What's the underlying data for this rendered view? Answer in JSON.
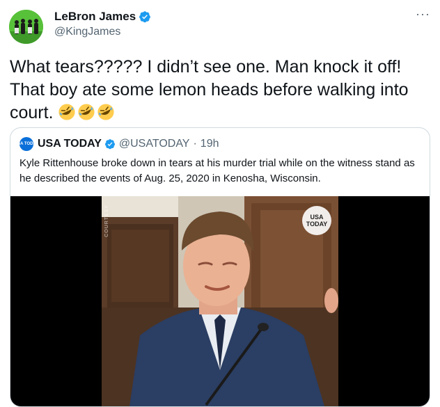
{
  "author": {
    "name": "LeBron James",
    "handle": "@KingJames",
    "avatar_color": "#58c13a"
  },
  "tweet": {
    "text": "What tears????? I didn’t see one. Man knock it off! That boy ate some lemon heads before walking into court.",
    "emojis": [
      "rolling-on-floor-laughing",
      "rolling-on-floor-laughing",
      "rolling-on-floor-laughing"
    ]
  },
  "quote": {
    "avatar_text": "USA TODAY",
    "name": "USA TODAY",
    "handle": "@USATODAY",
    "dot": "·",
    "time": "19h",
    "text": "Kyle Rittenhouse broke down in tears at his murder trial while on the witness stand as he described the events of Aug. 25, 2020 in Kenosha, Wisconsin.",
    "video": {
      "watermark": "USA TODAY",
      "courtesy": "COURTESY"
    }
  },
  "colors": {
    "verified_blue": "#1d9bf0",
    "secondary_text": "#536471",
    "border": "#cfd9de"
  },
  "more_label": "···"
}
